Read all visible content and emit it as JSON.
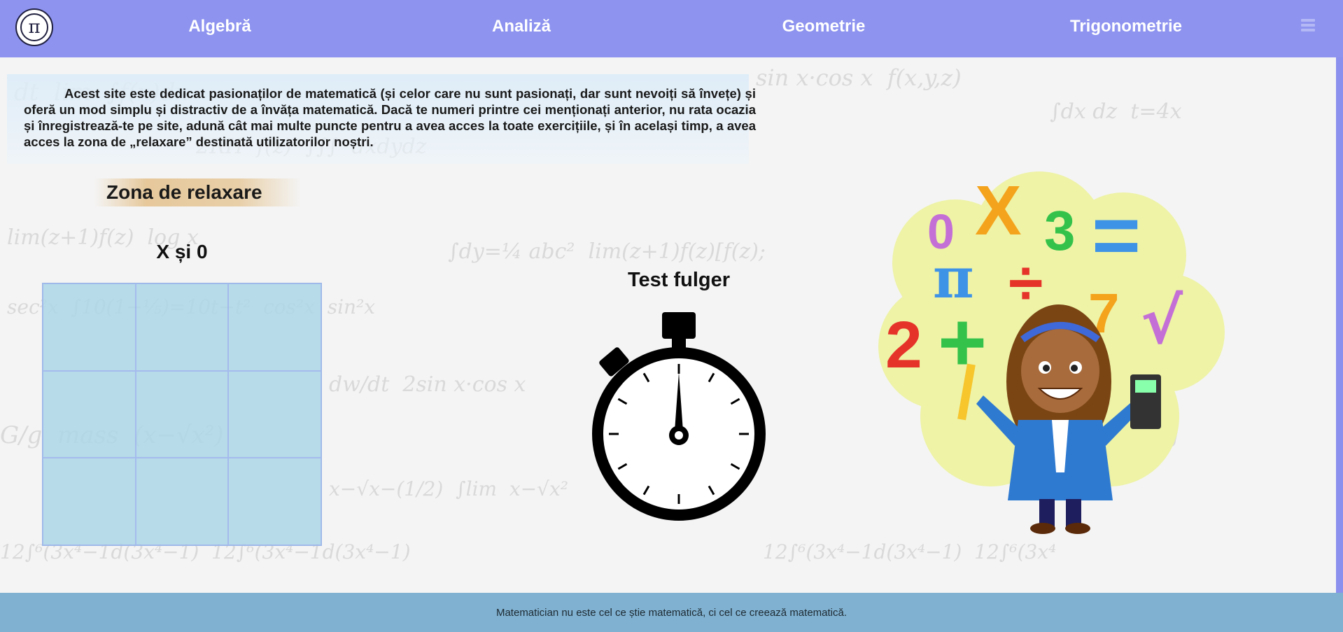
{
  "nav": {
    "logo_symbol": "π",
    "items": [
      {
        "label": "Algebră"
      },
      {
        "label": "Analiză"
      },
      {
        "label": "Geometrie"
      },
      {
        "label": "Trigonometrie"
      }
    ],
    "menu_icon": "hamburger-icon",
    "background_color": "#8d93ef"
  },
  "intro": {
    "text": "Acest site este dedicat pasionaților de matematică (și celor care nu sunt pasionați, dar sunt nevoiți să învețe) și oferă un mod simplu și distractiv de a învăța matematică. Dacă te numeri printre cei menționați anterior, nu rata ocazia și înregistrează-te pe site, adună cât mai multe puncte pentru a avea acces la toate exercițiile, și în același timp, a avea acces la zona de „relaxare” destinată utilizatorilor noștri."
  },
  "relax": {
    "heading": "Zona de relaxare",
    "tic_tac_toe": {
      "title": "X și 0",
      "cells": [
        "",
        "",
        "",
        "",
        "",
        "",
        "",
        "",
        ""
      ]
    },
    "quiz": {
      "title": "Test fulger",
      "icon": "stopwatch-icon"
    },
    "illustration": {
      "icon": "girl-with-math-symbols-illustration",
      "symbols": [
        "0",
        "X",
        "3",
        "=",
        "π",
        "÷",
        "2",
        "+",
        "7",
        "√"
      ]
    }
  },
  "footer": {
    "quote": "Matematician nu este cel ce știe matematică, ci cel ce creează matematică.",
    "background_color": "#80b1d0"
  }
}
